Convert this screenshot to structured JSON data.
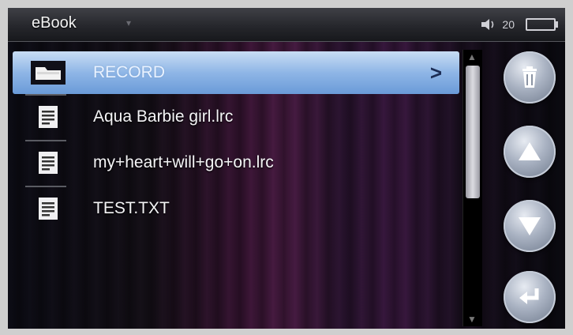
{
  "header": {
    "title": "eBook",
    "dropdown_glyph": "▾",
    "volume_icon": "speaker-icon",
    "volume_level": "20",
    "battery_icon": "battery-icon"
  },
  "list": {
    "items": [
      {
        "label": "RECORD",
        "icon": "folder-icon",
        "selected": true,
        "chevron": ">"
      },
      {
        "label": "Aqua  Barbie girl.lrc",
        "icon": "document-icon"
      },
      {
        "label": "my+heart+will+go+on.lrc",
        "icon": "document-icon"
      },
      {
        "label": "TEST.TXT",
        "icon": "document-icon"
      }
    ]
  },
  "scrollbar": {
    "up_glyph": "▲",
    "down_glyph": "▼"
  },
  "side_buttons": [
    {
      "name": "delete-button",
      "icon": "trash-icon"
    },
    {
      "name": "page-up-button",
      "icon": "arrow-up-icon"
    },
    {
      "name": "page-down-button",
      "icon": "arrow-down-icon"
    },
    {
      "name": "enter-button",
      "icon": "return-icon"
    }
  ],
  "colors": {
    "selection": "#8fb6e6",
    "button": "#a9b2c2"
  }
}
